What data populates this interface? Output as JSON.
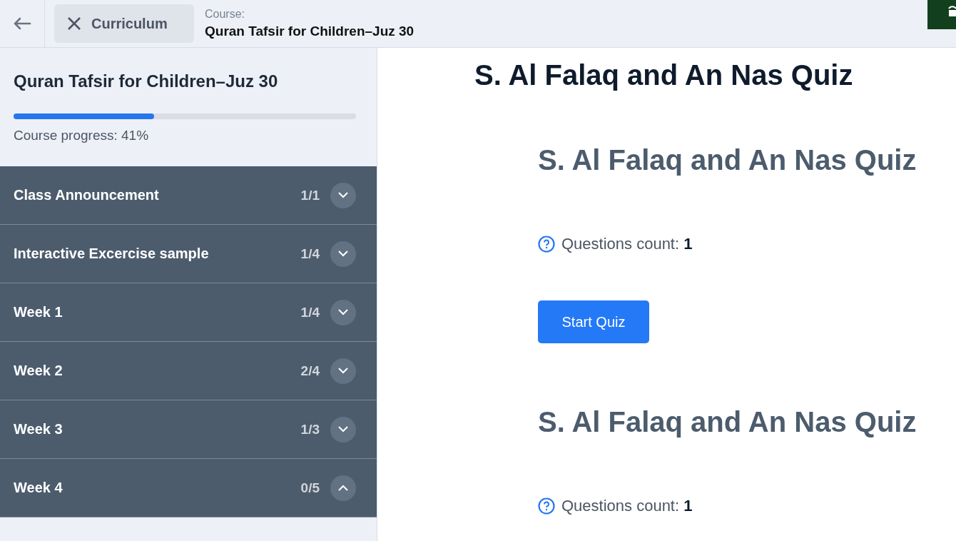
{
  "topbar": {
    "close_label": "Curriculum",
    "course_label": "Course:",
    "course_name": "Quran Tafsir for Children–Juz 30"
  },
  "sidebar": {
    "title": "Quran Tafsir for Children–Juz 30",
    "progress": {
      "level": 0.41,
      "label": "Course progress: 41%"
    },
    "sections": [
      {
        "title": "Class Announcement",
        "count": "1/1",
        "expanded": false
      },
      {
        "title": "Interactive Excercise sample",
        "count": "1/4",
        "expanded": false
      },
      {
        "title": "Week 1",
        "count": "1/4",
        "expanded": false
      },
      {
        "title": "Week 2",
        "count": "2/4",
        "expanded": false
      },
      {
        "title": "Week 3",
        "count": "1/3",
        "expanded": false
      },
      {
        "title": "Week 4",
        "count": "0/5",
        "expanded": true
      }
    ]
  },
  "main": {
    "title": "S. Al Falaq and An Nas Quiz",
    "quizzes": [
      {
        "title": "S. Al Falaq and An Nas Quiz",
        "questions_label": "Questions count:",
        "questions_count": "1",
        "button": "Start Quiz"
      },
      {
        "title": "S. Al Falaq and An Nas Quiz",
        "questions_label": "Questions count:",
        "questions_count": "1"
      }
    ]
  }
}
